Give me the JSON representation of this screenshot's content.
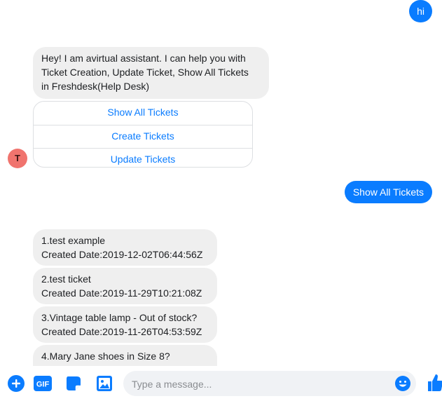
{
  "accent_color": "#0a7cff",
  "messages": {
    "user_hi": "hi",
    "bot_intro": {
      "line1": "Hey! I am avirtual assistant. I can help you with",
      "line2": "Ticket Creation, Update Ticket, Show All Tickets",
      "line3": "in Freshdesk(Help Desk)"
    },
    "quick_replies": [
      "Show All Tickets",
      "Create Tickets",
      "Update Tickets"
    ],
    "user_choice": "Show All Tickets",
    "tickets": [
      {
        "title": "1.test example",
        "created": "Created Date:2019-12-02T06:44:56Z"
      },
      {
        "title": "2.test ticket",
        "created": "Created Date:2019-11-29T10:21:08Z"
      },
      {
        "title": "3.Vintage table lamp - Out of stock?",
        "created": "Created Date:2019-11-26T04:53:59Z"
      },
      {
        "title": "4.Mary Jane shoes in Size 8?",
        "created": ""
      }
    ]
  },
  "avatar": {
    "initial": "T",
    "color": "#f0746e"
  },
  "composer": {
    "placeholder": "Type a message...",
    "gif_label": "GIF",
    "icons": [
      "plus-icon",
      "gif-icon",
      "sticker-icon",
      "image-icon",
      "emoji-icon",
      "thumbs-up-icon"
    ]
  }
}
